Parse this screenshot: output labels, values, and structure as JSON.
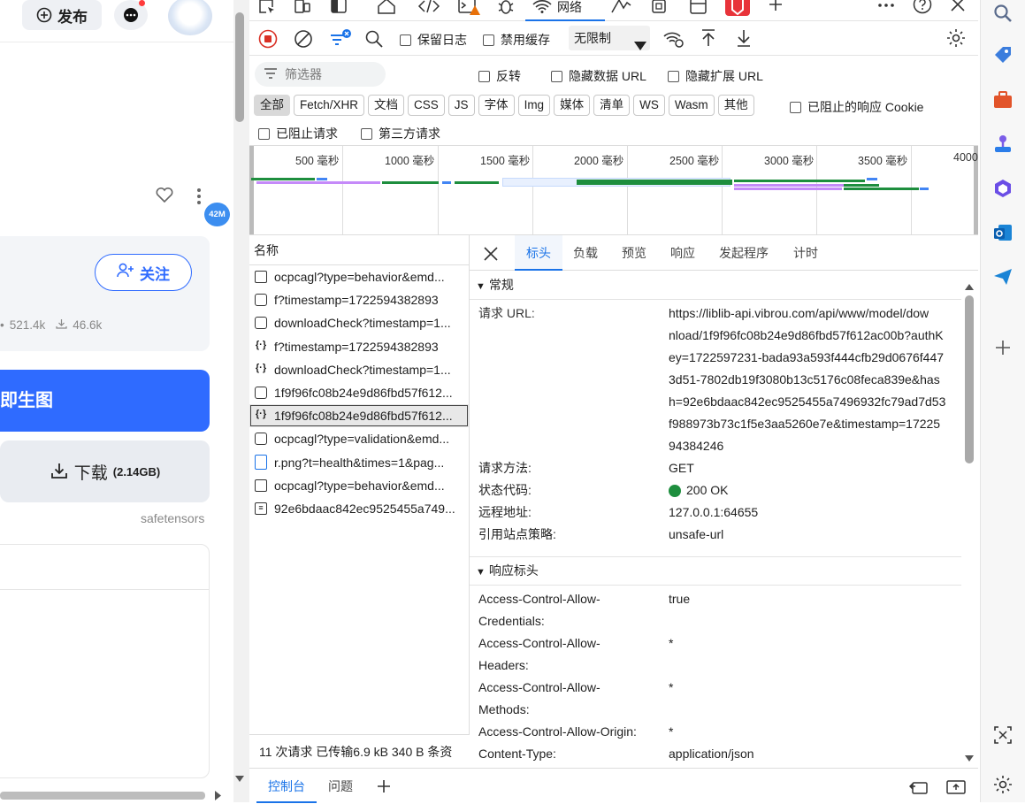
{
  "left": {
    "publish_label": "发布",
    "badge_42m": "42M",
    "follow_label": "关注",
    "stat_views": "521.4k",
    "stat_downloads": "46.6k",
    "generate_label": "即生图",
    "download_label": "下载",
    "download_size": "(2.14GB)",
    "format_label": "safetensors"
  },
  "toolbar": {
    "network_tab": "网络",
    "preserve_log": "保留日志",
    "disable_cache": "禁用缓存",
    "throttle": "无限制"
  },
  "filter": {
    "placeholder": "筛选器",
    "invert": "反转",
    "hide_data_url": "隐藏数据 URL",
    "hide_ext_url": "隐藏扩展 URL",
    "types": [
      "全部",
      "Fetch/XHR",
      "文档",
      "CSS",
      "JS",
      "字体",
      "Img",
      "媒体",
      "清单",
      "WS",
      "Wasm",
      "其他"
    ],
    "blocked_cookies": "已阻止的响应 Cookie",
    "blocked_requests": "已阻止请求",
    "third_party": "第三方请求"
  },
  "timeline": {
    "ticks": [
      "500 毫秒",
      "1000 毫秒",
      "1500 毫秒",
      "2000 毫秒",
      "2500 毫秒",
      "3000 毫秒",
      "3500 毫秒",
      "4000"
    ]
  },
  "requests": {
    "header": "名称",
    "items": [
      "ocpcagl?type=behavior&emd...",
      "f?timestamp=1722594382893",
      "downloadCheck?timestamp=1...",
      "f?timestamp=1722594382893",
      "downloadCheck?timestamp=1...",
      "1f9f96fc08b24e9d86fbd57f612...",
      "1f9f96fc08b24e9d86fbd57f612...",
      "ocpcagl?type=validation&emd...",
      "r.png?t=health&times=1&pag...",
      "ocpcagl?type=behavior&emd...",
      "92e6bdaac842ec9525455a749..."
    ],
    "status_bar": "11 次请求  已传输6.9 kB  340 B 条资"
  },
  "detail": {
    "tabs": [
      "标头",
      "负载",
      "预览",
      "响应",
      "发起程序",
      "计时"
    ],
    "general_title": "常规",
    "general": {
      "url_label": "请求 URL:",
      "url_lines": [
        "https://liblib-api.vibrou.com/api/www/model/dow",
        "nload/1f9f96fc08b24e9d86fbd57f612ac00b?authK",
        "ey=1722597231-bada93a593f444cfb29d0676f447",
        "3d51-7802db19f3080b13c5176c08feca839e&has",
        "h=92e6bdaac842ec9525455a7496932fc79ad7d53",
        "f988973b73c1f5e3aa5260e7e&timestamp=17225",
        "94384246"
      ],
      "method_label": "请求方法:",
      "method": "GET",
      "status_label": "状态代码:",
      "status": "200 OK",
      "remote_label": "远程地址:",
      "remote": "127.0.0.1:64655",
      "referrer_label": "引用站点策略:",
      "referrer": "unsafe-url"
    },
    "response_title": "响应标头",
    "response_headers": [
      {
        "k1": "Access-Control-Allow-",
        "k2": "Credentials:",
        "v": "true"
      },
      {
        "k1": "Access-Control-Allow-",
        "k2": "Headers:",
        "v": "*"
      },
      {
        "k1": "Access-Control-Allow-",
        "k2": "Methods:",
        "v": "*"
      },
      {
        "k1": "Access-Control-Allow-Origin:",
        "k2": "",
        "v": "*"
      },
      {
        "k1": "Content-Type:",
        "k2": "",
        "v": "application/json"
      }
    ]
  },
  "drawer": {
    "console": "控制台",
    "issues": "问题"
  },
  "colors": {
    "accent": "#1a73e8",
    "blue_button": "#2f6bff",
    "green": "#1e8e3e"
  }
}
